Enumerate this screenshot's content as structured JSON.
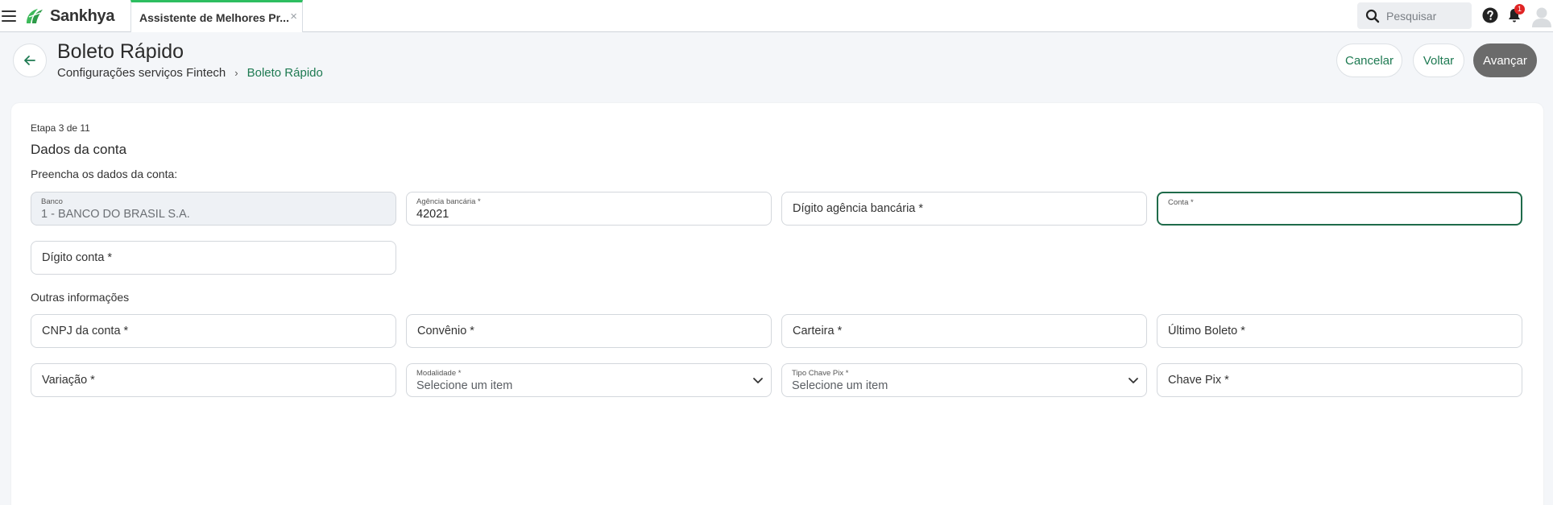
{
  "topbar": {
    "menu_icon": "hamburger-menu-icon",
    "brand_name": "Sankhya",
    "tab_label": "Assistente de Melhores Pr...",
    "tab_close": "×",
    "search_placeholder": "Pesquisar",
    "notification_count": "1"
  },
  "header": {
    "title": "Boleto Rápido",
    "breadcrumb": {
      "parent": "Configurações serviços Fintech",
      "separator": "›",
      "current": "Boleto Rápido"
    },
    "buttons": {
      "cancel": "Cancelar",
      "back": "Voltar",
      "next": "Avançar"
    }
  },
  "form": {
    "step": "Etapa 3 de 11",
    "section_title": "Dados da conta",
    "instruction": "Preencha os dados da conta:",
    "other_title": "Outras informações",
    "fields": {
      "banco": {
        "label": "Banco",
        "value": "1 - BANCO DO BRASIL S.A."
      },
      "agencia": {
        "label": "Agência bancária *",
        "value": "42021"
      },
      "digito_agencia": {
        "placeholder": "Dígito agência bancária *"
      },
      "conta": {
        "label": "Conta *",
        "value": ""
      },
      "digito_conta": {
        "placeholder": "Dígito conta *"
      },
      "cnpj": {
        "placeholder": "CNPJ da conta *"
      },
      "convenio": {
        "placeholder": "Convênio *"
      },
      "carteira": {
        "placeholder": "Carteira *"
      },
      "ultimo_boleto": {
        "placeholder": "Último Boleto *"
      },
      "variacao": {
        "placeholder": "Variação *"
      },
      "modalidade": {
        "label": "Modalidade *",
        "value": "Selecione um item"
      },
      "tipo_chave_pix": {
        "label": "Tipo Chave Pix *",
        "value": "Selecione um item"
      },
      "chave_pix": {
        "placeholder": "Chave Pix *"
      }
    }
  },
  "colors": {
    "accent_green": "#1e7a52",
    "tab_top_border": "#2dbe60",
    "primary_button": "#6b6b6b",
    "badge_red": "#e02424"
  }
}
